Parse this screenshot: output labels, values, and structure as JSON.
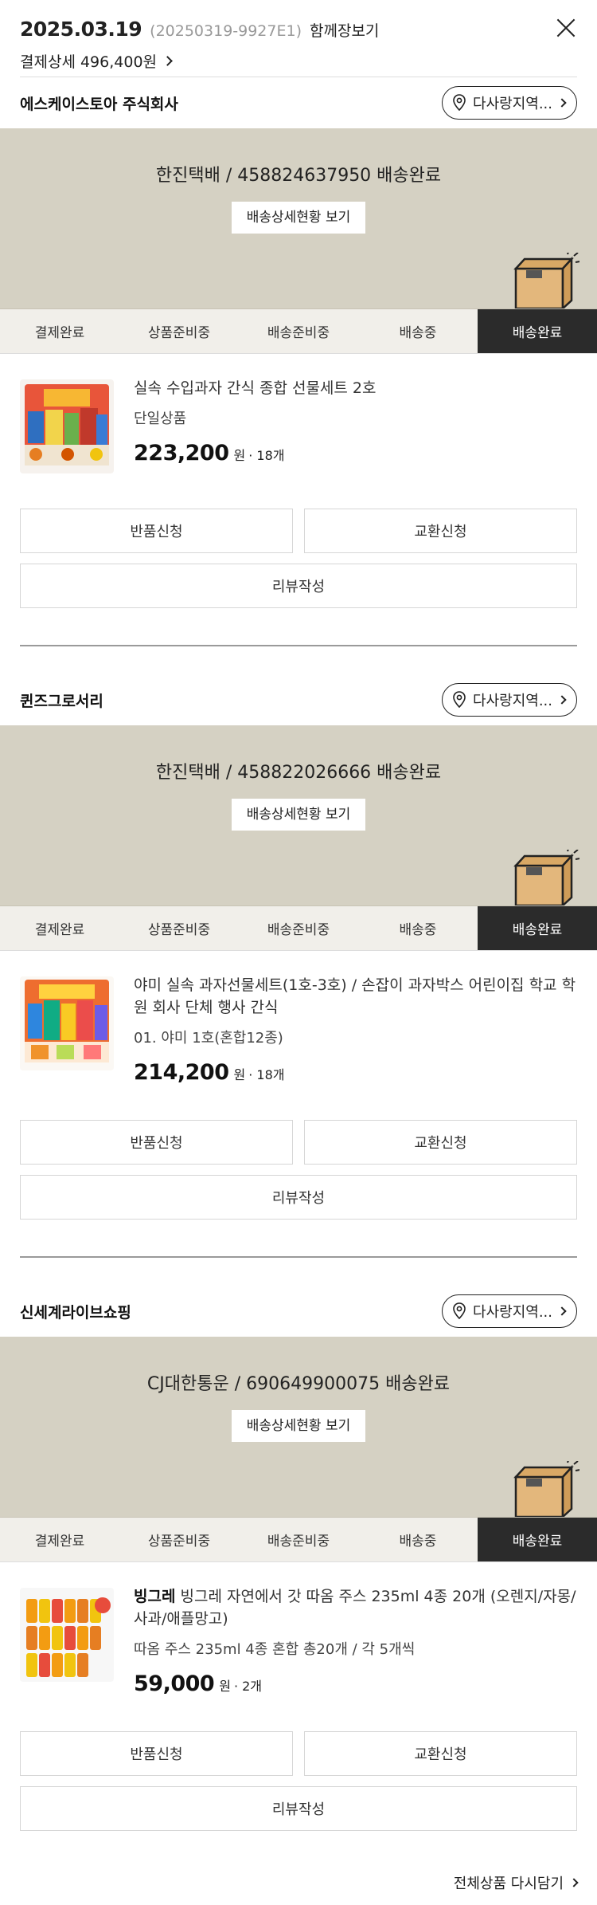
{
  "header": {
    "order_date": "2025.03.19",
    "order_number": "(20250319-9927E1)",
    "together_view": "함께장보기",
    "payment_detail": "결제상세 496,400원"
  },
  "steps": [
    "결제완료",
    "상품준비중",
    "배송준비중",
    "배송중",
    "배송완료"
  ],
  "active_step": "배송완료",
  "detail_button": "배송상세현황 보기",
  "sellers": [
    {
      "name": "에스케이스토아 주식회사",
      "address_button": "다사랑지역...",
      "tracking": "한진택배 / 458824637950 배송완료",
      "product": {
        "brand": "",
        "name": "실속 수입과자 간식 종합 선물세트 2호",
        "option": "단일상품",
        "price": "223,200",
        "unit": "원",
        "quantity": "· 18개"
      },
      "buttons": {
        "return": "반품신청",
        "exchange": "교환신청",
        "review": "리뷰작성"
      }
    },
    {
      "name": "퀸즈그로서리",
      "address_button": "다사랑지역...",
      "tracking": "한진택배 / 458822026666 배송완료",
      "product": {
        "brand": "",
        "name": "야미 실속 과자선물세트(1호-3호) / 손잡이 과자박스 어린이집 학교 학원 회사 단체 행사 간식",
        "option": "01. 야미 1호(혼합12종)",
        "price": "214,200",
        "unit": "원",
        "quantity": "· 18개"
      },
      "buttons": {
        "return": "반품신청",
        "exchange": "교환신청",
        "review": "리뷰작성"
      }
    },
    {
      "name": "신세계라이브쇼핑",
      "address_button": "다사랑지역...",
      "tracking": "CJ대한통운 / 690649900075 배송완료",
      "product": {
        "brand": "빙그레",
        "name": "빙그레 자연에서 갓 따옴 주스 235ml 4종 20개 (오렌지/자몽/사과/애플망고)",
        "option": "따옴 주스 235ml 4종 혼합 총20개 / 각 5개씩",
        "price": "59,000",
        "unit": "원",
        "quantity": "· 2개"
      },
      "buttons": {
        "return": "반품신청",
        "exchange": "교환신청",
        "review": "리뷰작성"
      }
    }
  ],
  "footer": {
    "reorder_all": "전체상품 다시담기"
  },
  "colors": {
    "tracking_bg": "#d5d1c3",
    "active_step_bg": "#2b2b2b",
    "box": "#e3b77c"
  }
}
